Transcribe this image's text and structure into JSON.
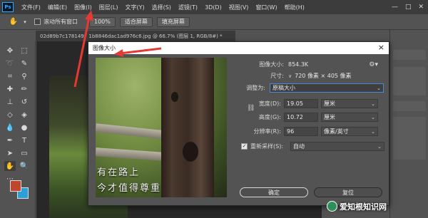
{
  "menubar": {
    "logo": "Ps",
    "items": [
      "文件(F)",
      "编辑(E)",
      "图像(I)",
      "图层(L)",
      "文字(Y)",
      "选择(S)",
      "滤镜(T)",
      "3D(D)",
      "视图(V)",
      "窗口(W)",
      "帮助(H)"
    ],
    "controls": [
      "—",
      "□",
      "✕"
    ]
  },
  "options": {
    "scroll_all_label": "滚动所有窗口",
    "zoom_value": "100%",
    "fit_screen": "适合屏幕",
    "fill_screen": "填充屏幕"
  },
  "document": {
    "tab_title": "02d89b7c1781497 1b8846dac1ad976c6.jpg @ 66.7% (图层 1, RGB/8#) *"
  },
  "dialog": {
    "title": "图像大小",
    "close": "×",
    "image_size_label": "图像大小:",
    "image_size_value": "854.3K",
    "dimensions_label": "尺寸:",
    "dimensions_value": "720 像素 × 405 像素",
    "fit_to_label": "调整为:",
    "fit_to_value": "原稿大小",
    "width_label": "宽度(D):",
    "width_value": "19.05",
    "width_unit": "厘米",
    "height_label": "高度(G):",
    "height_value": "10.72",
    "height_unit": "厘米",
    "resolution_label": "分辨率(R):",
    "resolution_value": "96",
    "resolution_unit": "像素/英寸",
    "resample_label": "重新采样(S):",
    "resample_value": "自动",
    "ok_label": "确定",
    "reset_label": "复位",
    "preview_text_line1": "有在路上",
    "preview_text_line2": "今才值得尊重"
  },
  "watermark": {
    "text": "爱知根知识网"
  },
  "colors": {
    "foreground": "#c1442f",
    "background": "#2a9fd8",
    "annotation": "#e53935"
  }
}
